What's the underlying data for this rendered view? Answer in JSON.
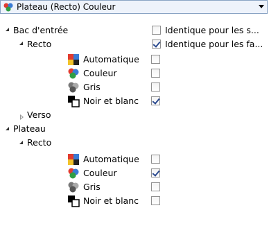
{
  "header": {
    "title": "Plateau (Recto) Couleur",
    "icon": "color-mode-icon"
  },
  "tree": {
    "bac": "Bac d'entrée",
    "bac_recto": "Recto",
    "verso": "Verso",
    "plateau": "Plateau",
    "plateau_recto": "Recto",
    "options": {
      "auto": "Automatique",
      "couleur": "Couleur",
      "gris": "Gris",
      "nb": "Noir et blanc"
    },
    "same_side": "Identique pour les s...",
    "same_face": "Identique pour les fa..."
  },
  "state": {
    "bac_same_side": false,
    "bac_same_face": true,
    "bac_auto": false,
    "bac_couleur": false,
    "bac_gris": false,
    "bac_nb": true,
    "plateau_auto": false,
    "plateau_couleur": true,
    "plateau_gris": false,
    "plateau_nb": false
  }
}
